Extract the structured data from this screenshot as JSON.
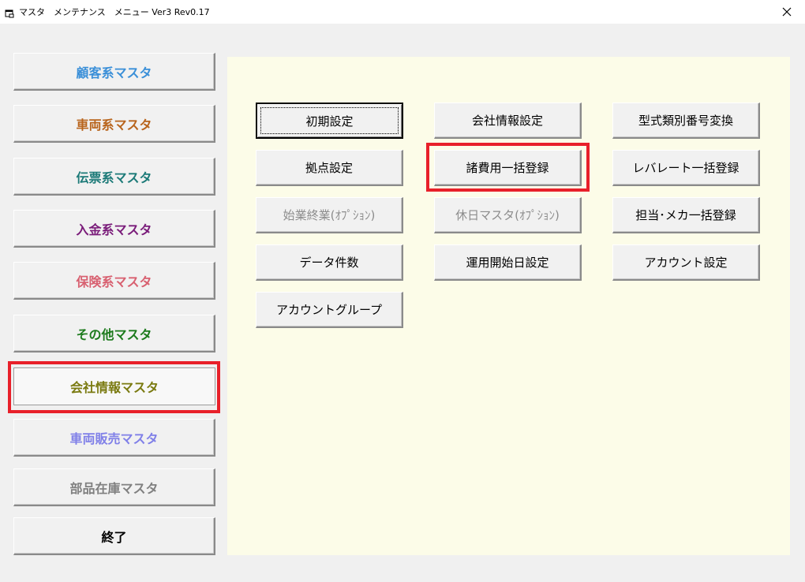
{
  "window": {
    "title": "マスタ　メンテナンス　メニュー Ver3 Rev0.17",
    "icon": "app-window-icon",
    "close_icon": "close-icon"
  },
  "sidebar": {
    "items": [
      {
        "label": "顧客系マスタ",
        "color": "#3a8fd8"
      },
      {
        "label": "車両系マスタ",
        "color": "#b8641c"
      },
      {
        "label": "伝票系マスタ",
        "color": "#1c7a78"
      },
      {
        "label": "入金系マスタ",
        "color": "#7a1c7a"
      },
      {
        "label": "保険系マスタ",
        "color": "#d86070"
      },
      {
        "label": "その他マスタ",
        "color": "#1c7a1c"
      },
      {
        "label": "会社情報マスタ",
        "color": "#7a7a10",
        "selected": true
      },
      {
        "label": "車両販売マスタ",
        "color": "#8080e8"
      },
      {
        "label": "部品在庫マスタ",
        "color": "#808080"
      },
      {
        "label": "終了",
        "color": "#000000"
      }
    ]
  },
  "panel": {
    "background": "#fcfce8",
    "buttons": [
      {
        "label": "初期設定",
        "state": "focused"
      },
      {
        "label": "会社情報設定",
        "state": "normal"
      },
      {
        "label": "型式類別番号変換",
        "state": "normal"
      },
      {
        "label": "拠点設定",
        "state": "normal"
      },
      {
        "label": "諸費用一括登録",
        "state": "normal"
      },
      {
        "label": "レバレート一括登録",
        "state": "normal"
      },
      {
        "label": "始業終業(ｵﾌﾟｼｮﾝ)",
        "state": "disabled"
      },
      {
        "label": "休日マスタ(ｵﾌﾟｼｮﾝ)",
        "state": "disabled"
      },
      {
        "label": "担当･メカ一括登録",
        "state": "normal"
      },
      {
        "label": "データ件数",
        "state": "normal"
      },
      {
        "label": "運用開始日設定",
        "state": "normal"
      },
      {
        "label": "アカウント設定",
        "state": "normal"
      },
      {
        "label": "アカウントグループ",
        "state": "normal"
      }
    ]
  },
  "annotations": {
    "highlight_color": "#e8202a"
  }
}
